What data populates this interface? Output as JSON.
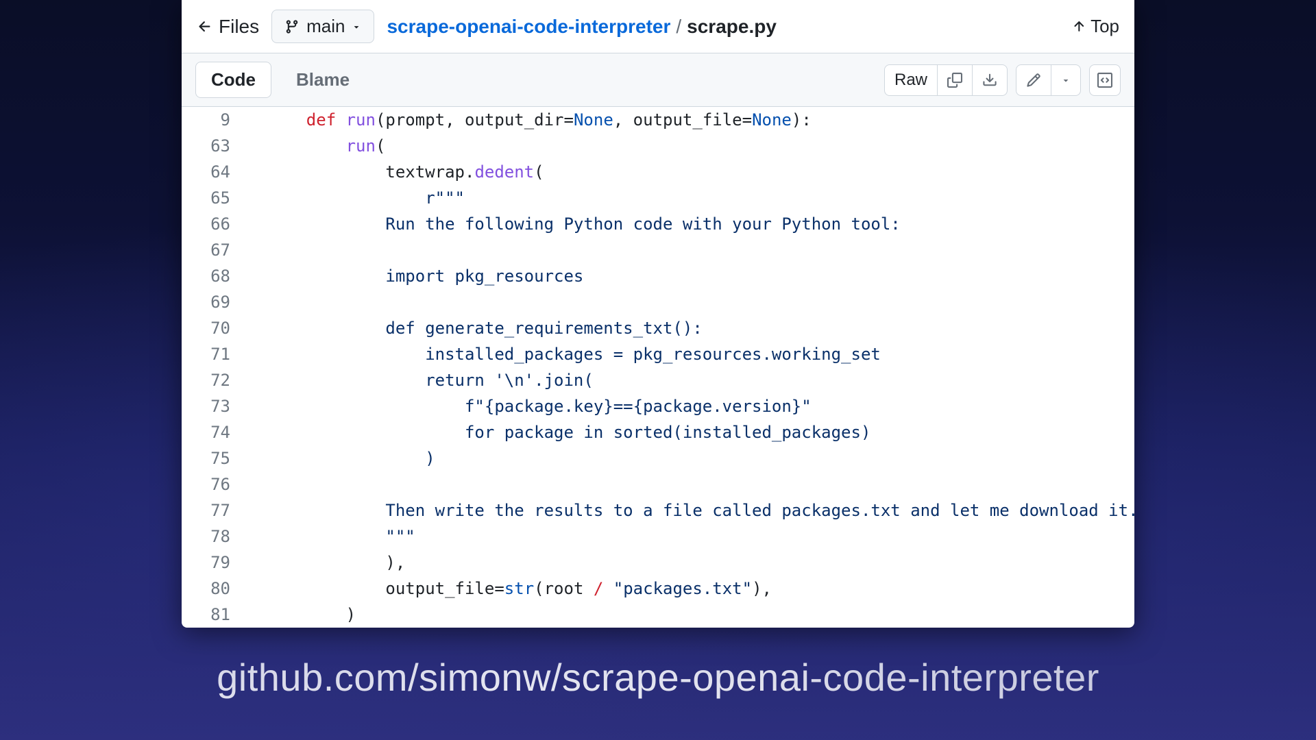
{
  "topbar": {
    "files_label": "Files",
    "branch_label": "main",
    "repo_name": "scrape-openai-code-interpreter",
    "separator": "/",
    "file_name": "scrape.py",
    "top_label": "Top"
  },
  "tabs": {
    "code": "Code",
    "blame": "Blame"
  },
  "actions": {
    "raw": "Raw"
  },
  "code_lines": [
    {
      "n": 9,
      "tokens": [
        [
          "    ",
          ""
        ],
        [
          "def ",
          "k-def"
        ],
        [
          "run",
          "k-fn"
        ],
        [
          "(",
          ""
        ],
        [
          "prompt",
          ""
        ],
        [
          ", ",
          ""
        ],
        [
          "output_dir",
          ""
        ],
        [
          "=",
          ""
        ],
        [
          "None",
          "k-const"
        ],
        [
          ", ",
          ""
        ],
        [
          "output_file",
          ""
        ],
        [
          "=",
          ""
        ],
        [
          "None",
          "k-const"
        ],
        [
          "):",
          ""
        ]
      ]
    },
    {
      "n": 63,
      "tokens": [
        [
          "        ",
          ""
        ],
        [
          "run",
          "k-fn"
        ],
        [
          "(",
          ""
        ]
      ]
    },
    {
      "n": 64,
      "tokens": [
        [
          "            textwrap.",
          ""
        ],
        [
          "dedent",
          "k-fn"
        ],
        [
          "(",
          ""
        ]
      ]
    },
    {
      "n": 65,
      "tokens": [
        [
          "                ",
          ""
        ],
        [
          "r\"\"\"",
          "k-str"
        ]
      ]
    },
    {
      "n": 66,
      "tokens": [
        [
          "            ",
          ""
        ],
        [
          "Run the following Python code with your Python tool:",
          "k-str"
        ]
      ]
    },
    {
      "n": 67,
      "tokens": [
        [
          "",
          ""
        ]
      ]
    },
    {
      "n": 68,
      "tokens": [
        [
          "            ",
          ""
        ],
        [
          "import pkg_resources",
          "k-str"
        ]
      ]
    },
    {
      "n": 69,
      "tokens": [
        [
          "",
          ""
        ]
      ]
    },
    {
      "n": 70,
      "tokens": [
        [
          "            ",
          ""
        ],
        [
          "def generate_requirements_txt():",
          "k-str"
        ]
      ]
    },
    {
      "n": 71,
      "tokens": [
        [
          "                ",
          ""
        ],
        [
          "installed_packages = pkg_resources.working_set",
          "k-str"
        ]
      ]
    },
    {
      "n": 72,
      "tokens": [
        [
          "                ",
          ""
        ],
        [
          "return '\\n'.join(",
          "k-str"
        ]
      ]
    },
    {
      "n": 73,
      "tokens": [
        [
          "                    ",
          ""
        ],
        [
          "f\"{package.key}=={package.version}\"",
          "k-str"
        ]
      ]
    },
    {
      "n": 74,
      "tokens": [
        [
          "                    ",
          ""
        ],
        [
          "for package in sorted(installed_packages)",
          "k-str"
        ]
      ]
    },
    {
      "n": 75,
      "tokens": [
        [
          "                ",
          ""
        ],
        [
          ")",
          "k-str"
        ]
      ]
    },
    {
      "n": 76,
      "tokens": [
        [
          "",
          ""
        ]
      ]
    },
    {
      "n": 77,
      "tokens": [
        [
          "            ",
          ""
        ],
        [
          "Then write the results to a file called packages.txt and let me download it.",
          "k-str"
        ]
      ]
    },
    {
      "n": 78,
      "tokens": [
        [
          "            ",
          ""
        ],
        [
          "\"\"\"",
          "k-str"
        ]
      ]
    },
    {
      "n": 79,
      "tokens": [
        [
          "            ),",
          ""
        ]
      ]
    },
    {
      "n": 80,
      "tokens": [
        [
          "            output_file",
          ""
        ],
        [
          "=",
          ""
        ],
        [
          "str",
          "k-builtin"
        ],
        [
          "(root ",
          ""
        ],
        [
          "/ ",
          "k-def"
        ],
        [
          "\"packages.txt\"",
          "k-str"
        ],
        [
          "),",
          ""
        ]
      ]
    },
    {
      "n": 81,
      "tokens": [
        [
          "        )",
          ""
        ]
      ]
    }
  ],
  "caption": "github.com/simonw/scrape-openai-code-interpreter"
}
